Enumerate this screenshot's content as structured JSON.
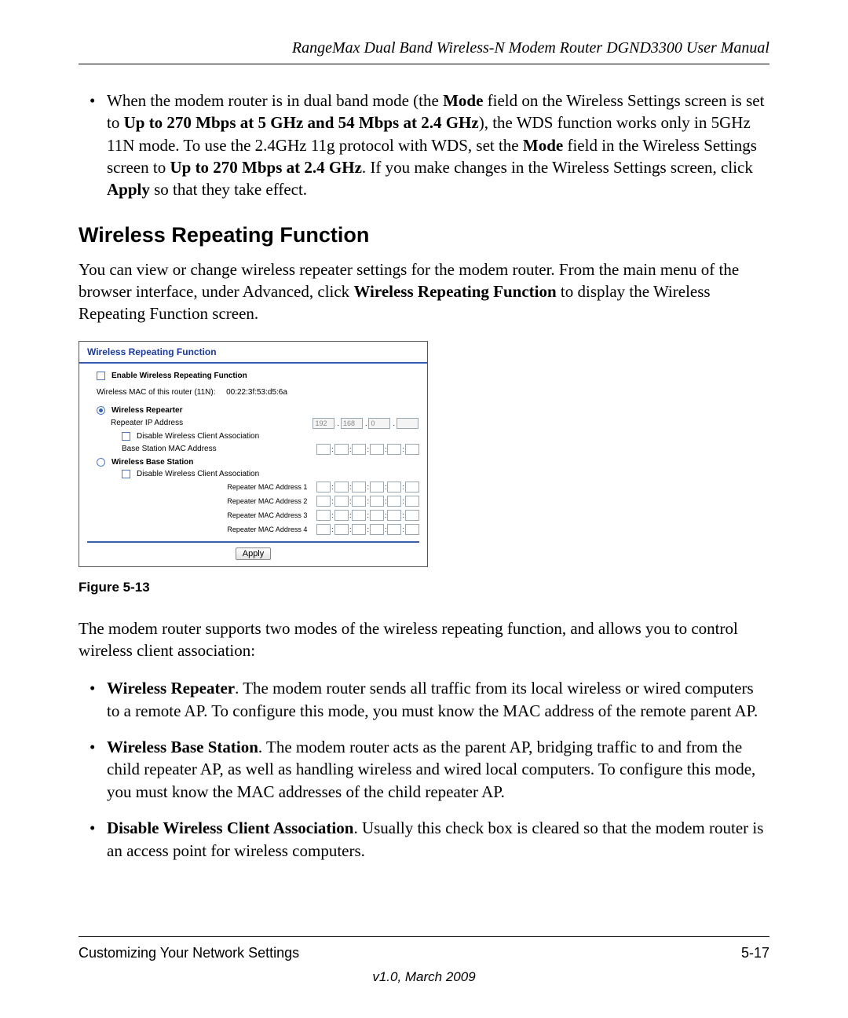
{
  "header": "RangeMax Dual Band Wireless-N Modem Router DGND3300 User Manual",
  "intro_bullet_prefix": "When the modem router is in dual band mode (the ",
  "intro_bullet_bold1": "Mode",
  "intro_bullet_mid1": " field on the Wireless Settings screen is set to ",
  "intro_bullet_bold2": "Up to 270 Mbps at 5 GHz and 54 Mbps at 2.4 GHz",
  "intro_bullet_mid2": "), the WDS function works only in 5GHz 11N mode. To use the 2.4GHz 11g protocol with WDS, set the ",
  "intro_bullet_bold3": "Mode",
  "intro_bullet_mid3": " field in the Wireless Settings screen to ",
  "intro_bullet_bold4": "Up to 270 Mbps at 2.4 GHz",
  "intro_bullet_mid4": ". If you make changes in the Wireless Settings screen, click ",
  "intro_bullet_bold5": "Apply",
  "intro_bullet_end": " so that they take effect.",
  "section_heading": "Wireless Repeating Function",
  "intro_para_a": "You can view or change wireless repeater settings for the modem router. From the main menu of the browser interface, under Advanced, click ",
  "intro_para_bold": "Wireless Repeating Function",
  "intro_para_b": " to display the Wireless Repeating Function screen.",
  "ui": {
    "title": "Wireless Repeating Function",
    "enable_label": "Enable Wireless Repeating Function",
    "mac_label_prefix": "Wireless MAC of this router (11N):",
    "mac_value": "00:22:3f:53:d5:6a",
    "repeater_heading": "Wireless Repearter",
    "repeater_ip_label": "Repeater IP Address",
    "repeater_ip": [
      "192",
      "168",
      "0",
      ""
    ],
    "disable_assoc_label": "Disable Wireless Client Association",
    "base_mac_label": "Base Station MAC Address",
    "base_heading": "Wireless Base Station",
    "repeater_mac_labels": [
      "Repeater MAC Address 1",
      "Repeater MAC Address 2",
      "Repeater MAC Address 3",
      "Repeater MAC Address 4"
    ],
    "apply_label": "Apply"
  },
  "figure_caption": "Figure 5-13",
  "modes_intro": "The modem router supports two modes of the wireless repeating function, and allows you to control wireless client association:",
  "modes": [
    {
      "bold": "Wireless Repeater",
      "text": ". The modem router sends all traffic from its local wireless or wired computers to a remote AP. To configure this mode, you must know the MAC address of the remote parent AP."
    },
    {
      "bold": "Wireless Base Station",
      "text": ". The modem router acts as the parent AP, bridging traffic to and from the child repeater AP, as well as handling wireless and wired local computers. To configure this mode, you must know the MAC addresses of the child repeater AP."
    },
    {
      "bold": "Disable Wireless Client Association",
      "text": ". Usually this check box is cleared so that the modem router is an access point for wireless computers."
    }
  ],
  "footer": {
    "left": "Customizing Your Network Settings",
    "right": "5-17",
    "version": "v1.0, March 2009"
  }
}
